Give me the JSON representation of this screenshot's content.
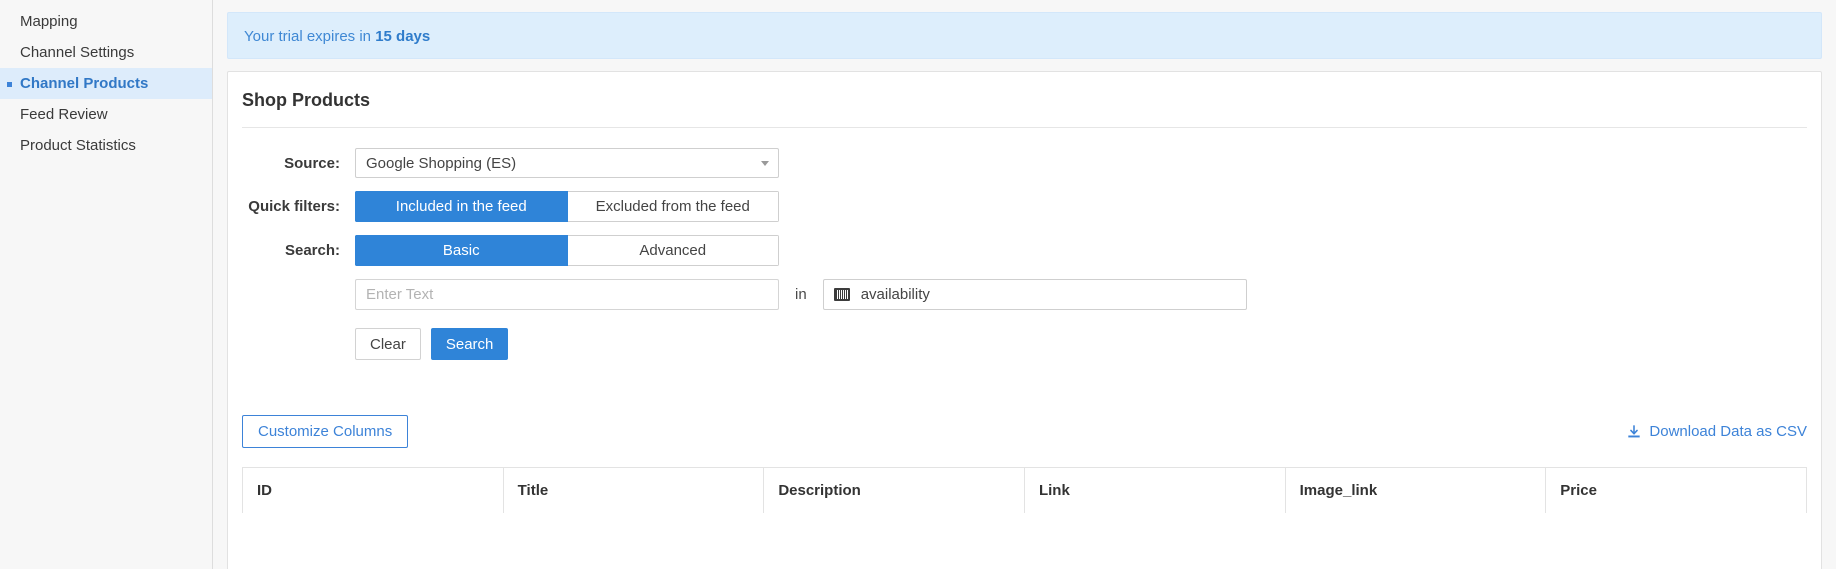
{
  "sidebar": {
    "items": [
      {
        "label": "Mapping",
        "active": false
      },
      {
        "label": "Channel Settings",
        "active": false
      },
      {
        "label": "Channel Products",
        "active": true
      },
      {
        "label": "Feed Review",
        "active": false
      },
      {
        "label": "Product Statistics",
        "active": false
      }
    ]
  },
  "banner": {
    "prefix": "Your trial expires in ",
    "highlight": "15 days",
    "text_color": "#3f88d4",
    "background": "#ddeefc"
  },
  "panel": {
    "title": "Shop Products"
  },
  "form": {
    "source": {
      "label": "Source:",
      "value": "Google Shopping (ES)"
    },
    "quick_filters": {
      "label": "Quick filters:",
      "options": [
        "Included in the feed",
        "Excluded from the feed"
      ],
      "selected": "Included in the feed"
    },
    "search_mode": {
      "label": "Search:",
      "options": [
        "Basic",
        "Advanced"
      ],
      "selected": "Basic"
    },
    "search_text": {
      "value": "",
      "placeholder": "Enter Text"
    },
    "in_word": "in",
    "search_field": {
      "icon": "barcode-icon",
      "value": "availability"
    },
    "clear_button": "Clear",
    "search_button": "Search"
  },
  "table_tools": {
    "customize_columns": "Customize Columns",
    "download_csv": "Download Data as CSV",
    "download_icon": "download-icon"
  },
  "table": {
    "columns": [
      "ID",
      "Title",
      "Description",
      "Link",
      "Image_link",
      "Price"
    ]
  },
  "colors": {
    "accent": "#2f84d8",
    "link": "#3d83d8",
    "active_nav_bg": "#ddecfb"
  }
}
